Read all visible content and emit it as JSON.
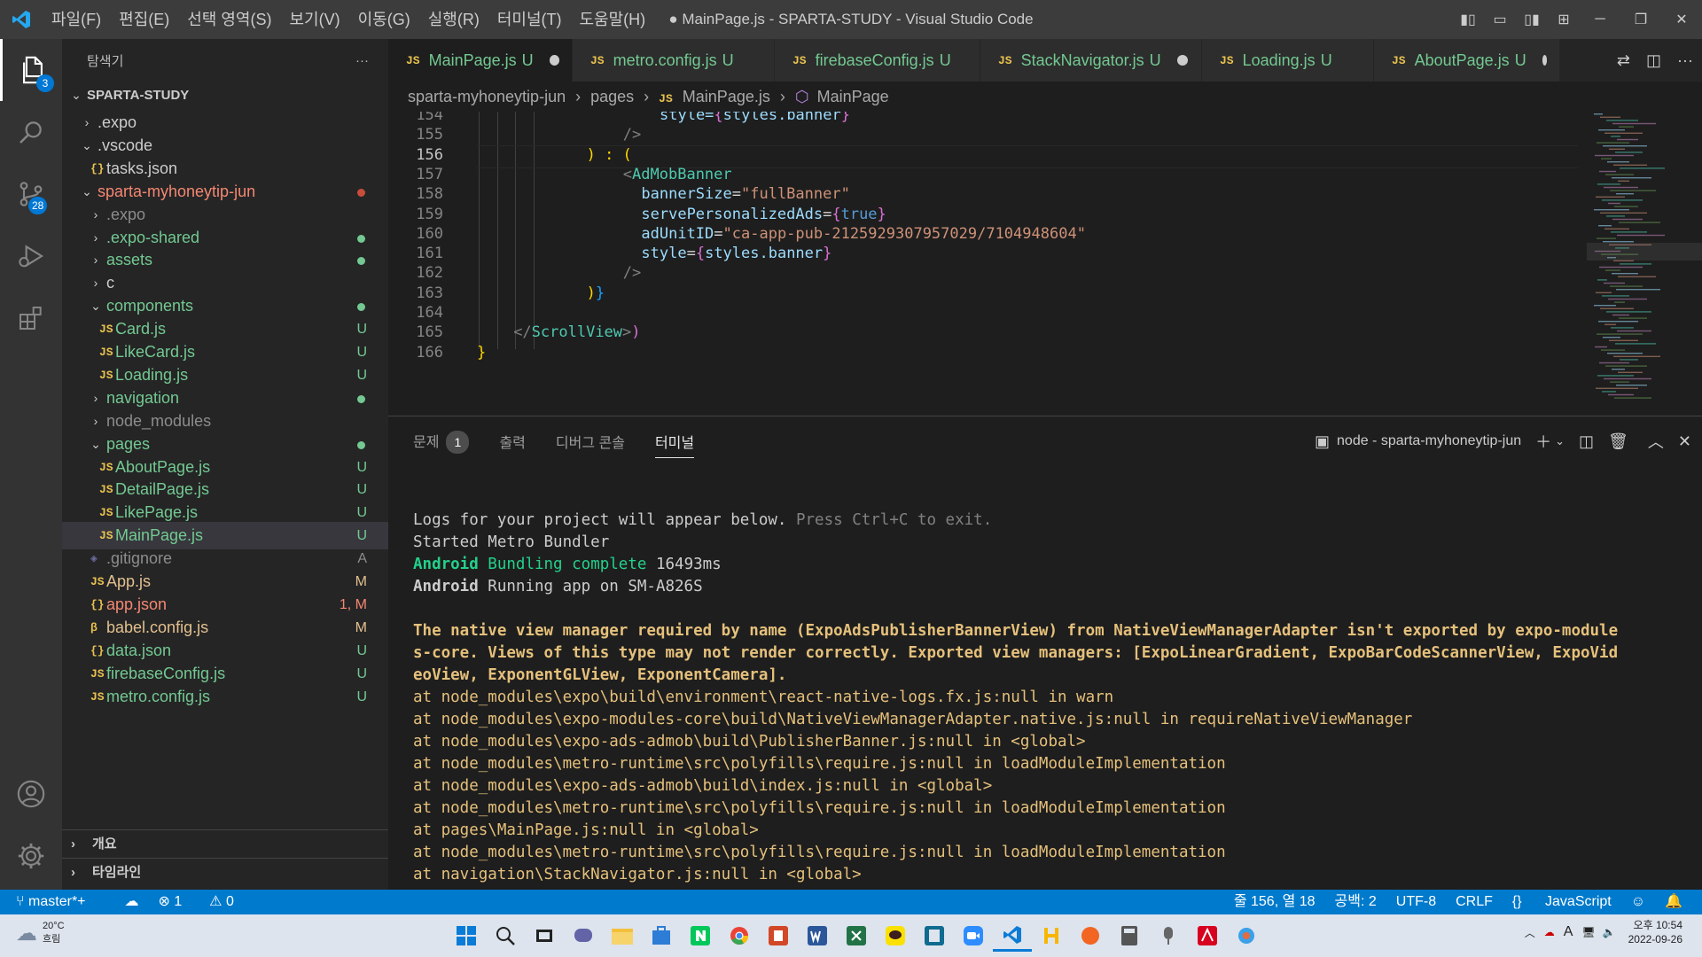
{
  "window": {
    "title": "● MainPage.js - SPARTA-STUDY - Visual Studio Code",
    "menu": [
      "파일(F)",
      "편집(E)",
      "선택 영역(S)",
      "보기(V)",
      "이동(G)",
      "실행(R)",
      "터미널(T)",
      "도움말(H)"
    ]
  },
  "activity": {
    "explorer_badge": "3",
    "scm_badge": "28"
  },
  "sidebar": {
    "title": "탐색기",
    "more": "···",
    "root": "SPARTA-STUDY",
    "items": [
      {
        "name": ".expo",
        "kind": "folder",
        "open": false,
        "depth": 1,
        "color": "#cccccc",
        "status": "",
        "dot": ""
      },
      {
        "name": ".vscode",
        "kind": "folder",
        "open": true,
        "depth": 1,
        "color": "#cccccc",
        "status": "",
        "dot": ""
      },
      {
        "name": "tasks.json",
        "kind": "json",
        "depth": 2,
        "color": "#cccccc",
        "status": "",
        "dot": ""
      },
      {
        "name": "sparta-myhoneytip-jun",
        "kind": "folder",
        "open": true,
        "depth": 1,
        "color": "#f48771",
        "status": "",
        "dot": "#c74e39"
      },
      {
        "name": ".expo",
        "kind": "folder",
        "open": false,
        "depth": 2,
        "color": "#8c8c8c",
        "status": "",
        "dot": ""
      },
      {
        "name": ".expo-shared",
        "kind": "folder",
        "open": false,
        "depth": 2,
        "color": "#73c991",
        "status": "",
        "dot": "#73c991"
      },
      {
        "name": "assets",
        "kind": "folder",
        "open": false,
        "depth": 2,
        "color": "#73c991",
        "status": "",
        "dot": "#73c991"
      },
      {
        "name": "c",
        "kind": "folder",
        "open": false,
        "depth": 2,
        "color": "#cccccc",
        "status": "",
        "dot": ""
      },
      {
        "name": "components",
        "kind": "folder",
        "open": true,
        "depth": 2,
        "color": "#73c991",
        "status": "",
        "dot": "#73c991"
      },
      {
        "name": "Card.js",
        "kind": "js",
        "depth": 3,
        "color": "#73c991",
        "status": "U",
        "dot": ""
      },
      {
        "name": "LikeCard.js",
        "kind": "js",
        "depth": 3,
        "color": "#73c991",
        "status": "U",
        "dot": ""
      },
      {
        "name": "Loading.js",
        "kind": "js",
        "depth": 3,
        "color": "#73c991",
        "status": "U",
        "dot": ""
      },
      {
        "name": "navigation",
        "kind": "folder",
        "open": false,
        "depth": 2,
        "color": "#73c991",
        "status": "",
        "dot": "#73c991"
      },
      {
        "name": "node_modules",
        "kind": "folder",
        "open": false,
        "depth": 2,
        "color": "#8c8c8c",
        "status": "",
        "dot": ""
      },
      {
        "name": "pages",
        "kind": "folder",
        "open": true,
        "depth": 2,
        "color": "#73c991",
        "status": "",
        "dot": "#73c991"
      },
      {
        "name": "AboutPage.js",
        "kind": "js",
        "depth": 3,
        "color": "#73c991",
        "status": "U",
        "dot": ""
      },
      {
        "name": "DetailPage.js",
        "kind": "js",
        "depth": 3,
        "color": "#73c991",
        "status": "U",
        "dot": ""
      },
      {
        "name": "LikePage.js",
        "kind": "js",
        "depth": 3,
        "color": "#73c991",
        "status": "U",
        "dot": ""
      },
      {
        "name": "MainPage.js",
        "kind": "js",
        "depth": 3,
        "color": "#73c991",
        "status": "U",
        "dot": "",
        "selected": true
      },
      {
        "name": ".gitignore",
        "kind": "git",
        "depth": 2,
        "color": "#8c8c8c",
        "status": "A",
        "dot": ""
      },
      {
        "name": "App.js",
        "kind": "js",
        "depth": 2,
        "color": "#e2c08d",
        "status": "M",
        "dot": ""
      },
      {
        "name": "app.json",
        "kind": "json",
        "depth": 2,
        "color": "#f48771",
        "status": "1, M",
        "dot": ""
      },
      {
        "name": "babel.config.js",
        "kind": "babel",
        "depth": 2,
        "color": "#e2c08d",
        "status": "M",
        "dot": ""
      },
      {
        "name": "data.json",
        "kind": "json",
        "depth": 2,
        "color": "#73c991",
        "status": "U",
        "dot": ""
      },
      {
        "name": "firebaseConfig.js",
        "kind": "js",
        "depth": 2,
        "color": "#73c991",
        "status": "U",
        "dot": ""
      },
      {
        "name": "metro.config.js",
        "kind": "js",
        "depth": 2,
        "color": "#73c991",
        "status": "U",
        "dot": ""
      }
    ],
    "outline": "개요",
    "timeline": "타임라인"
  },
  "tabs": [
    {
      "name": "MainPage.js",
      "status": "U",
      "dirty": true,
      "active": true
    },
    {
      "name": "metro.config.js",
      "status": "U",
      "dirty": false,
      "active": false
    },
    {
      "name": "firebaseConfig.js",
      "status": "U",
      "dirty": false,
      "active": false
    },
    {
      "name": "StackNavigator.js",
      "status": "U",
      "dirty": true,
      "active": false
    },
    {
      "name": "Loading.js",
      "status": "U",
      "dirty": false,
      "active": false
    },
    {
      "name": "AboutPage.js",
      "status": "U",
      "dirty": true,
      "active": false
    }
  ],
  "breadcrumb": {
    "folder": "sparta-myhoneytip-jun",
    "sub": "pages",
    "file": "MainPage.js",
    "symbol": "MainPage"
  },
  "editor": {
    "current_line": 156,
    "lines": [
      {
        "n": "154",
        "indent": 10,
        "parts": [
          [
            "style=",
            "#9cdcfe"
          ],
          [
            "{",
            "#da70d6"
          ],
          [
            "styles.banner",
            "#9cdcfe"
          ],
          [
            "}",
            "#da70d6"
          ]
        ]
      },
      {
        "n": "155",
        "indent": 8,
        "parts": [
          [
            "/>",
            "#808080"
          ]
        ]
      },
      {
        "n": "156",
        "indent": 6,
        "parts": [
          [
            ") : (",
            "#ffd700"
          ]
        ]
      },
      {
        "n": "157",
        "indent": 8,
        "parts": [
          [
            "<",
            "#808080"
          ],
          [
            "AdMobBanner",
            "#4ec9b0"
          ]
        ]
      },
      {
        "n": "158",
        "indent": 9,
        "parts": [
          [
            "bannerSize",
            "#9cdcfe"
          ],
          [
            "=",
            "#d4d4d4"
          ],
          [
            "\"fullBanner\"",
            "#ce9178"
          ]
        ]
      },
      {
        "n": "159",
        "indent": 9,
        "parts": [
          [
            "servePersonalizedAds",
            "#9cdcfe"
          ],
          [
            "=",
            "#d4d4d4"
          ],
          [
            "{",
            "#da70d6"
          ],
          [
            "true",
            "#569cd6"
          ],
          [
            "}",
            "#da70d6"
          ]
        ]
      },
      {
        "n": "160",
        "indent": 9,
        "parts": [
          [
            "adUnitID",
            "#9cdcfe"
          ],
          [
            "=",
            "#d4d4d4"
          ],
          [
            "\"ca-app-pub-2125929307957029/7104948604\"",
            "#ce9178"
          ]
        ]
      },
      {
        "n": "161",
        "indent": 9,
        "parts": [
          [
            "style",
            "#9cdcfe"
          ],
          [
            "=",
            "#d4d4d4"
          ],
          [
            "{",
            "#da70d6"
          ],
          [
            "styles.banner",
            "#9cdcfe"
          ],
          [
            "}",
            "#da70d6"
          ]
        ]
      },
      {
        "n": "162",
        "indent": 8,
        "parts": [
          [
            "/>",
            "#808080"
          ]
        ]
      },
      {
        "n": "163",
        "indent": 6,
        "parts": [
          [
            ")",
            "#ffd700"
          ],
          [
            "}",
            "#179fff"
          ]
        ]
      },
      {
        "n": "164",
        "indent": 0,
        "parts": []
      },
      {
        "n": "165",
        "indent": 2,
        "parts": [
          [
            "</",
            "#808080"
          ],
          [
            "ScrollView",
            "#4ec9b0"
          ],
          [
            ">",
            "#808080"
          ],
          [
            ")",
            "#da70d6"
          ]
        ]
      },
      {
        "n": "166",
        "indent": 0,
        "parts": [
          [
            "}",
            "#ffd700"
          ]
        ]
      }
    ]
  },
  "panel": {
    "tabs": {
      "problems": "문제",
      "problems_count": "1",
      "output": "출력",
      "debug": "디버그 콘솔",
      "terminal": "터미널"
    },
    "terminal_name": "node - sparta-myhoneytip-jun",
    "terminal": [
      {
        "segs": [
          [
            "Logs for your project will appear below. ",
            "#cccccc"
          ],
          [
            "Press Ctrl+C to exit.",
            "#808080"
          ]
        ]
      },
      {
        "segs": [
          [
            "Started Metro Bundler",
            "#cccccc"
          ]
        ]
      },
      {
        "segs": [
          [
            "Android ",
            "#23d18b",
            true
          ],
          [
            "Bundling complete",
            "#23d18b"
          ],
          [
            " 16493ms",
            "#cccccc"
          ]
        ]
      },
      {
        "segs": [
          [
            "Android ",
            "#cccccc",
            true
          ],
          [
            "Running app on SM-A826S",
            "#cccccc"
          ]
        ]
      },
      {
        "segs": [
          [
            "",
            "#cccccc"
          ]
        ]
      },
      {
        "segs": [
          [
            "The native view manager required by name (ExpoAdsPublisherBannerView) from NativeViewManagerAdapter isn't exported by expo-module",
            "#e5c07b",
            true
          ]
        ]
      },
      {
        "segs": [
          [
            "s-core. Views of this type may not render correctly. Exported view managers: [ExpoLinearGradient, ExpoBarCodeScannerView, ExpoVid",
            "#e5c07b",
            true
          ]
        ]
      },
      {
        "segs": [
          [
            "eoView, ExponentGLView, ExponentCamera].",
            "#e5c07b",
            true
          ]
        ]
      },
      {
        "segs": [
          [
            "at node_modules\\expo\\build\\environment\\react-native-logs.fx.js:null in warn",
            "#e5c07b"
          ]
        ]
      },
      {
        "segs": [
          [
            "at node_modules\\expo-modules-core\\build\\NativeViewManagerAdapter.native.js:null in requireNativeViewManager",
            "#e5c07b"
          ]
        ]
      },
      {
        "segs": [
          [
            "at node_modules\\expo-ads-admob\\build\\PublisherBanner.js:null in <global>",
            "#e5c07b"
          ]
        ]
      },
      {
        "segs": [
          [
            "at node_modules\\metro-runtime\\src\\polyfills\\require.js:null in loadModuleImplementation",
            "#e5c07b"
          ]
        ]
      },
      {
        "segs": [
          [
            "at node_modules\\expo-ads-admob\\build\\index.js:null in <global>",
            "#e5c07b"
          ]
        ]
      },
      {
        "segs": [
          [
            "at node_modules\\metro-runtime\\src\\polyfills\\require.js:null in loadModuleImplementation",
            "#e5c07b"
          ]
        ]
      },
      {
        "segs": [
          [
            "at pages\\MainPage.js:null in <global>",
            "#e5c07b"
          ]
        ]
      },
      {
        "segs": [
          [
            "at node_modules\\metro-runtime\\src\\polyfills\\require.js:null in loadModuleImplementation",
            "#e5c07b"
          ]
        ]
      },
      {
        "segs": [
          [
            "at navigation\\StackNavigator.js:null in <global>",
            "#e5c07b"
          ]
        ]
      }
    ]
  },
  "status": {
    "branch": "master*+",
    "errors": "1",
    "warnings": "0",
    "position": "줄 156, 열 18",
    "spaces": "공백: 2",
    "encoding": "UTF-8",
    "eol": "CRLF",
    "language": "JavaScript"
  },
  "taskbar": {
    "temp": "20°C",
    "weather": "흐림",
    "ime": "A",
    "time": "오후 10:54",
    "date": "2022-09-26"
  }
}
